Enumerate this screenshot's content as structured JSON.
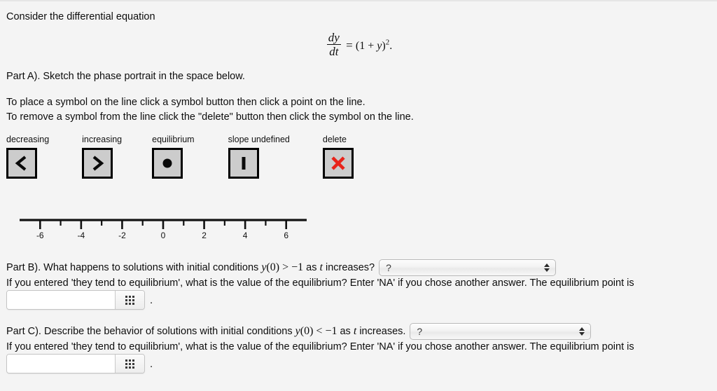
{
  "intro": {
    "text": "Consider the differential equation"
  },
  "equation": {
    "numerator": "dy",
    "denominator": "dt",
    "equals": "=",
    "rhs_open": "(1 + ",
    "rhs_var": "y",
    "rhs_close": ")",
    "exponent": "2",
    "period": ".",
    "plain": "dy/dt = (1 + y)^2."
  },
  "partA": {
    "prompt": "Part A). Sketch the phase portrait in the space below.",
    "instruction1": "To place a symbol on the line click a symbol button then click a point on the line.",
    "instruction2": "To remove a symbol from the line click the \"delete\" button then click the symbol on the line.",
    "tools": [
      {
        "label": "decreasing",
        "icon": "left-chevron-icon"
      },
      {
        "label": "increasing",
        "icon": "right-chevron-icon"
      },
      {
        "label": "equilibrium",
        "icon": "filled-dot-icon"
      },
      {
        "label": "slope undefined",
        "icon": "vertical-bar-icon"
      },
      {
        "label": "delete",
        "icon": "red-x-icon"
      }
    ],
    "numberline": {
      "min": -7,
      "max": 7,
      "major_ticks": [
        -6,
        -4,
        -2,
        0,
        2,
        4,
        6
      ],
      "major_labels": [
        "-6",
        "-4",
        "-2",
        "0",
        "2",
        "4",
        "6"
      ],
      "minor_ticks": [
        -5,
        -3,
        -1,
        1,
        3,
        5
      ],
      "axis_color": "#111111"
    }
  },
  "partB": {
    "question_pre": "Part B). What happens to solutions with initial conditions ",
    "question_math_var": "y",
    "question_math_arg": "(0)",
    "question_math_rel": " > −1",
    "question_mid": " as ",
    "question_math_t": "t",
    "question_post": " increases?",
    "select_value": "?",
    "sub_prompt": "If you entered 'they tend to equilibrium', what is the value of the equilibrium? Enter 'NA' if you chose another answer. The equilibrium point is",
    "answer_value": "",
    "answer_placeholder": "",
    "keypad_icon": "math-keypad-grid-icon",
    "trailing_period": "."
  },
  "partC": {
    "question_pre": "Part C). Describe the behavior of solutions with initial conditions ",
    "question_math_var": "y",
    "question_math_arg": "(0)",
    "question_math_rel": " < −1",
    "question_mid": " as ",
    "question_math_t": "t",
    "question_post": " increases.",
    "select_value": "?",
    "sub_prompt": "If you entered 'they tend to equilibrium', what is the value of the equilibrium? Enter 'NA' if you chose another answer. The equilibrium point is",
    "answer_value": "",
    "answer_placeholder": "",
    "keypad_icon": "math-keypad-grid-icon",
    "trailing_period": "."
  },
  "colors": {
    "page_background": "#f4f4f4",
    "text": "#0d0d0d",
    "button_face": "#cccccc",
    "button_border": "#000000",
    "delete_red": "#e8231a"
  }
}
